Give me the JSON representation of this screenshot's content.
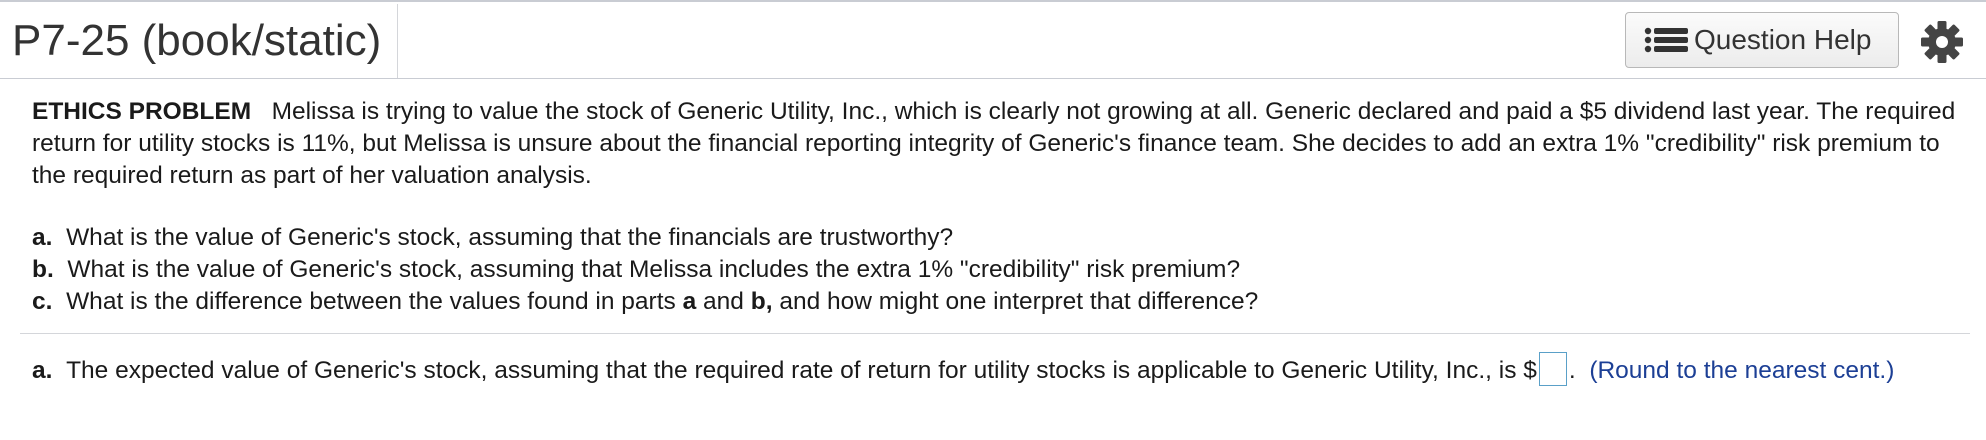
{
  "header": {
    "title": "P7-25 (book/static)",
    "help_label": "Question Help",
    "help_icon": "list-icon",
    "settings_icon": "gear-icon"
  },
  "problem": {
    "lead": "ETHICS PROBLEM",
    "text": "Melissa is trying to value the stock of Generic Utility, Inc., which is clearly not growing at all.  Generic declared and paid a $5 dividend last year. The required return for utility stocks is 11%, but Melissa is unsure about the financial reporting integrity of Generic's finance team.  She decides to add an extra 1% \"credibility\" risk premium to the required return as part of her valuation analysis."
  },
  "parts": [
    {
      "letter": "a.",
      "text": "What is the value of Generic's stock, assuming that the financials are trustworthy?"
    },
    {
      "letter": "b.",
      "text": "What is the value of Generic's stock, assuming that Melissa includes the extra 1% \"credibility\" risk premium?"
    },
    {
      "letter": "c.",
      "text_1": "What is the difference between the values found in parts",
      "bold_a": "a",
      "text_2": "and",
      "bold_b": "b,",
      "text_3": "and how might one interpret that difference?"
    }
  ],
  "answer": {
    "letter": "a.",
    "prefix": "The expected value of Generic's stock, assuming that the required rate of return for utility stocks is applicable to Generic Utility, Inc., is $",
    "input_value": "",
    "suffix": ".",
    "hint": "(Round to the nearest cent.)"
  },
  "colors": {
    "hint": "#1c3f95",
    "input_border": "#5aa0c8",
    "title": "#333333"
  }
}
